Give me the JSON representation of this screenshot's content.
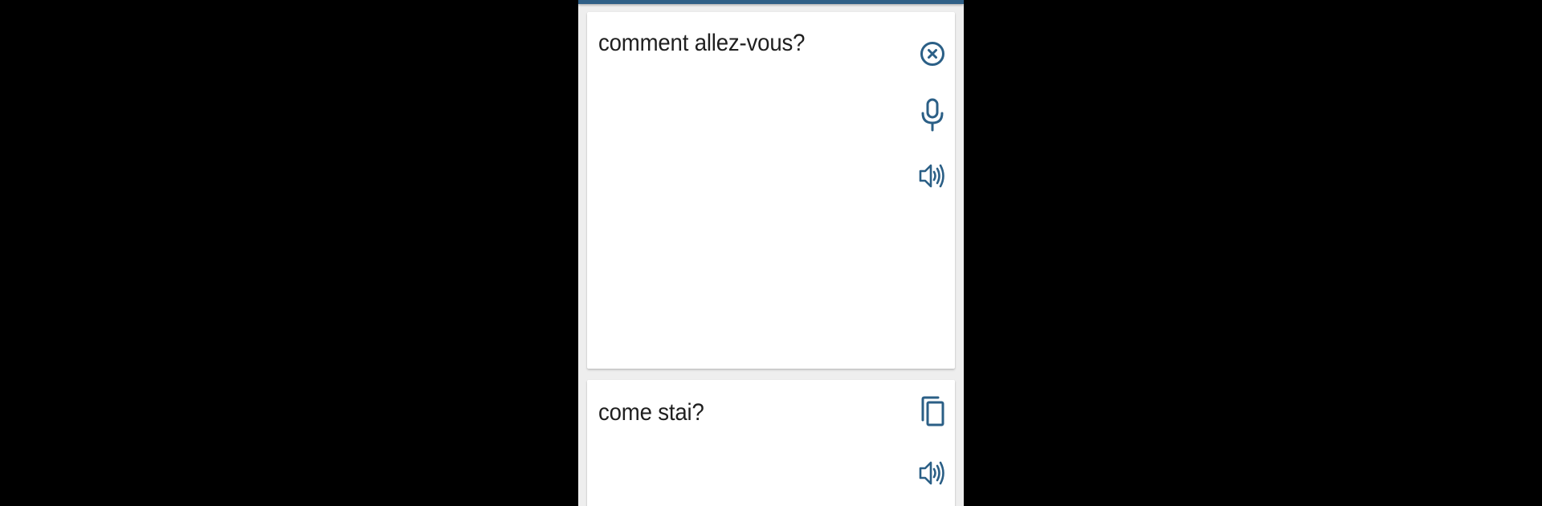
{
  "source": {
    "text": "comment allez-vous?",
    "icons": [
      "clear-icon",
      "microphone-icon",
      "speaker-icon"
    ]
  },
  "target": {
    "text": "come stai?",
    "icons": [
      "copy-icon",
      "speaker-icon"
    ]
  },
  "colors": {
    "icon": "#2b5f86",
    "appbar": "#2f5f86",
    "background": "#eeeeee",
    "card": "#ffffff",
    "text": "#1f1f1f",
    "letterbox": "#000000"
  }
}
